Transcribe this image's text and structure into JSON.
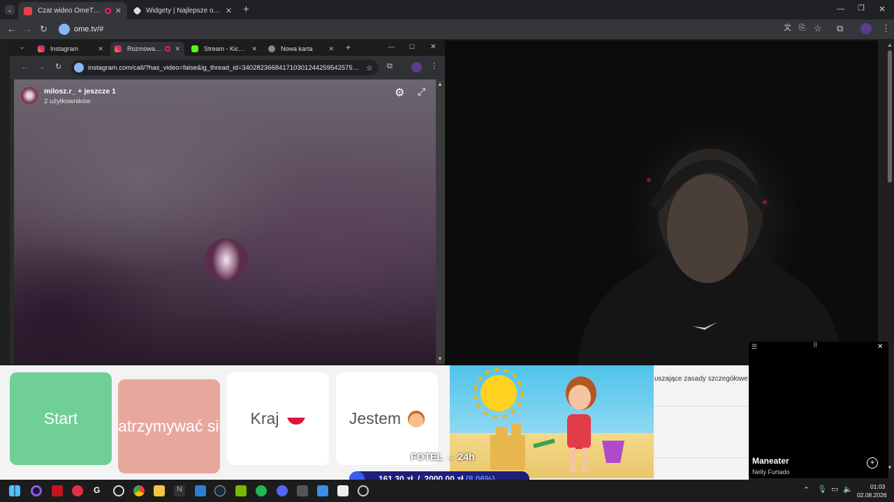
{
  "outer_browser": {
    "tabs": [
      {
        "label": "Czat wideo OmeTV — alter",
        "active": true
      },
      {
        "label": "Widgety | Najlepsze oprogramo",
        "active": false
      }
    ],
    "url": "ome.tv/#",
    "new_tab": "+"
  },
  "inner_browser": {
    "tabs": [
      {
        "label": "Instagram"
      },
      {
        "label": "Rozmowa na"
      },
      {
        "label": "Stream - Kick Das"
      },
      {
        "label": "Nowa karta"
      }
    ],
    "url": "instagram.com/call/?has_video=false&ig_thread_id=340282366841710301244259542575840..."
  },
  "call": {
    "title": "milosz.r_ + jeszcze 1",
    "subtitle": "2 użytkowników"
  },
  "buttons": {
    "start": "Start",
    "stop": "Zatrzymywać się",
    "country": "Kraj",
    "iam": "Jestem"
  },
  "rules_text": "uszające zasady szczegółowe",
  "overlay": {
    "fotel": "FOTEL → 24h",
    "donation_current": "161,30 zł",
    "donation_separator": "/",
    "donation_goal": "2000,00 zł",
    "donation_percent": "(8.06%)",
    "donation_progress": 0.0806
  },
  "music": {
    "title": "Maneater",
    "artist": "Nelly Furtado"
  },
  "taskbar": {
    "time": "01:03",
    "date": "02.08.2026"
  },
  "colors": {
    "start_button": "#6fcf97",
    "stop_button": "#e8a79c",
    "end_call": "#e0232e"
  }
}
